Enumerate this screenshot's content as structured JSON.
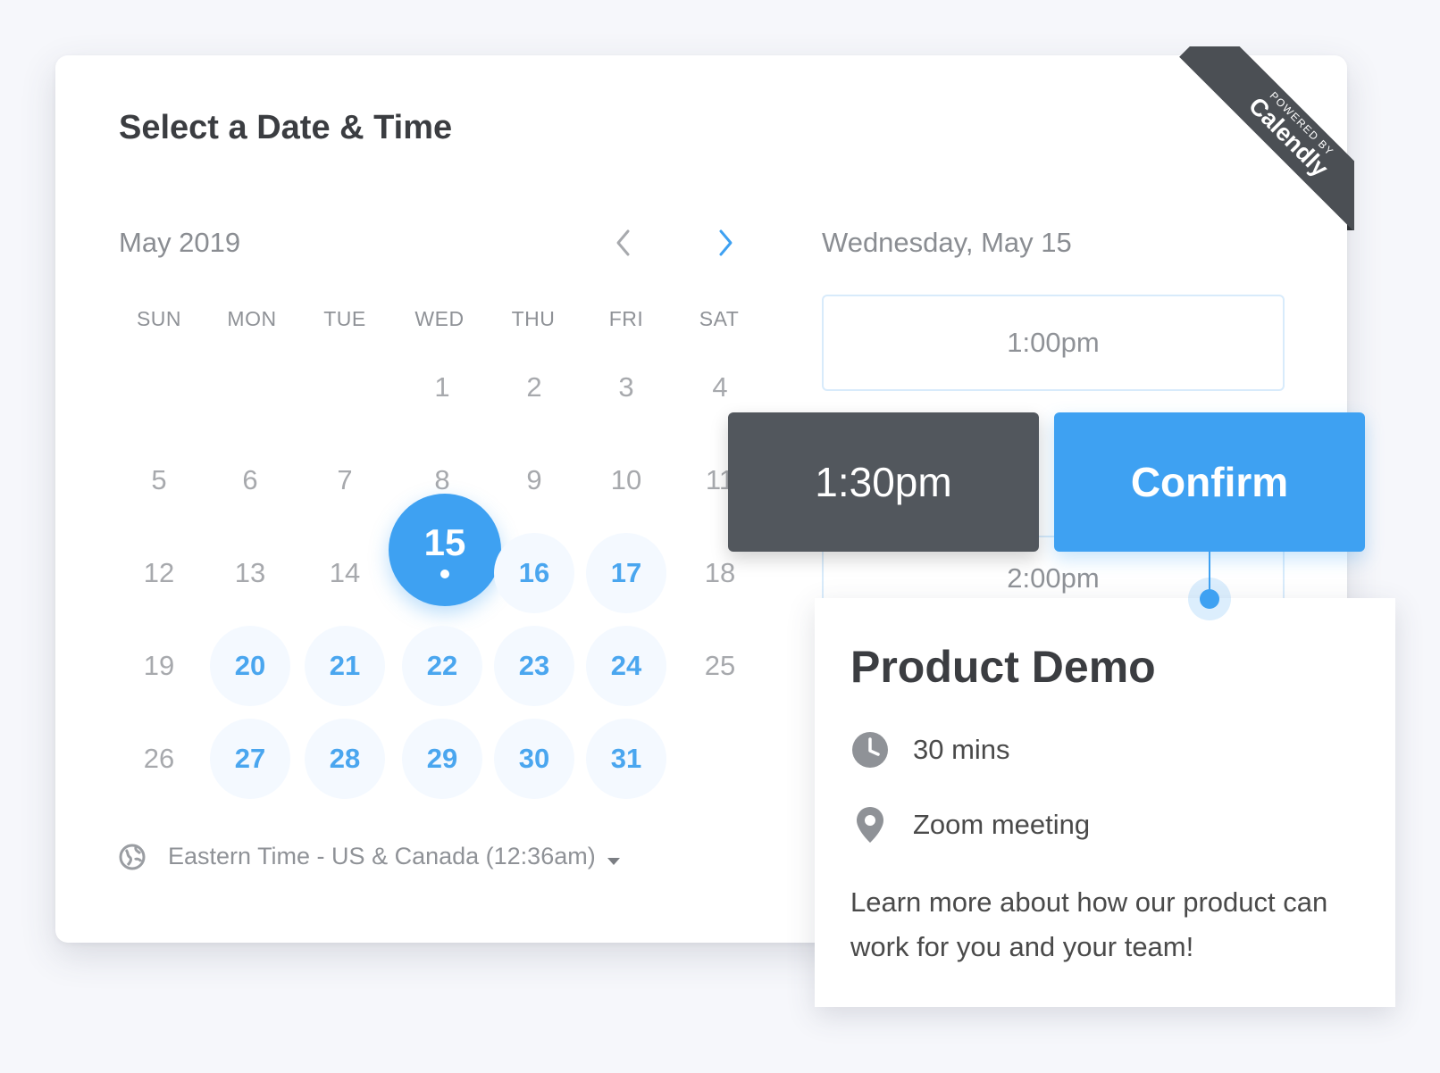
{
  "header": {
    "title": "Select a Date & Time"
  },
  "ribbon": {
    "small_text": "POWERED BY",
    "brand": "Calendly"
  },
  "calendar": {
    "month_label": "May 2019",
    "weekdays": [
      "SUN",
      "MON",
      "TUE",
      "WED",
      "THU",
      "FRI",
      "SAT"
    ],
    "selected_day": "15"
  },
  "timezone": {
    "label": "Eastern Time - US & Canada (12:36am)"
  },
  "times": {
    "date_label": "Wednesday, May 15",
    "slots": [
      "1:00pm",
      "1:30pm",
      "2:00pm"
    ],
    "selected": "1:30pm",
    "confirm_label": "Confirm"
  },
  "event": {
    "title": "Product Demo",
    "duration": "30 mins",
    "location": "Zoom meeting",
    "description": "Learn more about how our product can work for you and your team!"
  },
  "colors": {
    "accent": "#3ea1f2",
    "dark": "#52575d",
    "available_bg": "#f4f9ff"
  },
  "icons": {
    "prev": "chevron-left-icon",
    "next": "chevron-right-icon",
    "globe": "globe-icon",
    "caret": "caret-down-icon",
    "clock": "clock-icon",
    "location": "map-pin-icon"
  }
}
